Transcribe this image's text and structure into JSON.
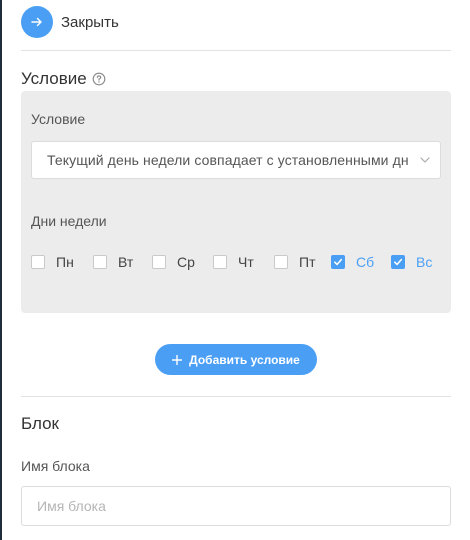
{
  "header": {
    "close_label": "Закрыть"
  },
  "condition_section": {
    "title": "Условие",
    "panel": {
      "condition_label": "Условие",
      "condition_value": "Текущий день недели совпадает с установленными днями",
      "weekdays_label": "Дни недели",
      "days": [
        {
          "label": "Пн",
          "checked": false
        },
        {
          "label": "Вт",
          "checked": false
        },
        {
          "label": "Ср",
          "checked": false
        },
        {
          "label": "Чт",
          "checked": false
        },
        {
          "label": "Пт",
          "checked": false
        },
        {
          "label": "Сб",
          "checked": true
        },
        {
          "label": "Вс",
          "checked": true
        }
      ]
    },
    "add_button_label": "Добавить условие"
  },
  "block_section": {
    "title": "Блок",
    "name_label": "Имя блока",
    "name_placeholder": "Имя блока",
    "name_value": ""
  },
  "colors": {
    "accent": "#4a9ff5",
    "panel_bg": "#ececec",
    "divider": "#e3e3e3"
  },
  "icons": {
    "close": "arrow-right-icon",
    "help": "question-circle-icon",
    "select": "chevron-down-icon",
    "add": "plus-icon",
    "check": "checkmark-icon"
  }
}
